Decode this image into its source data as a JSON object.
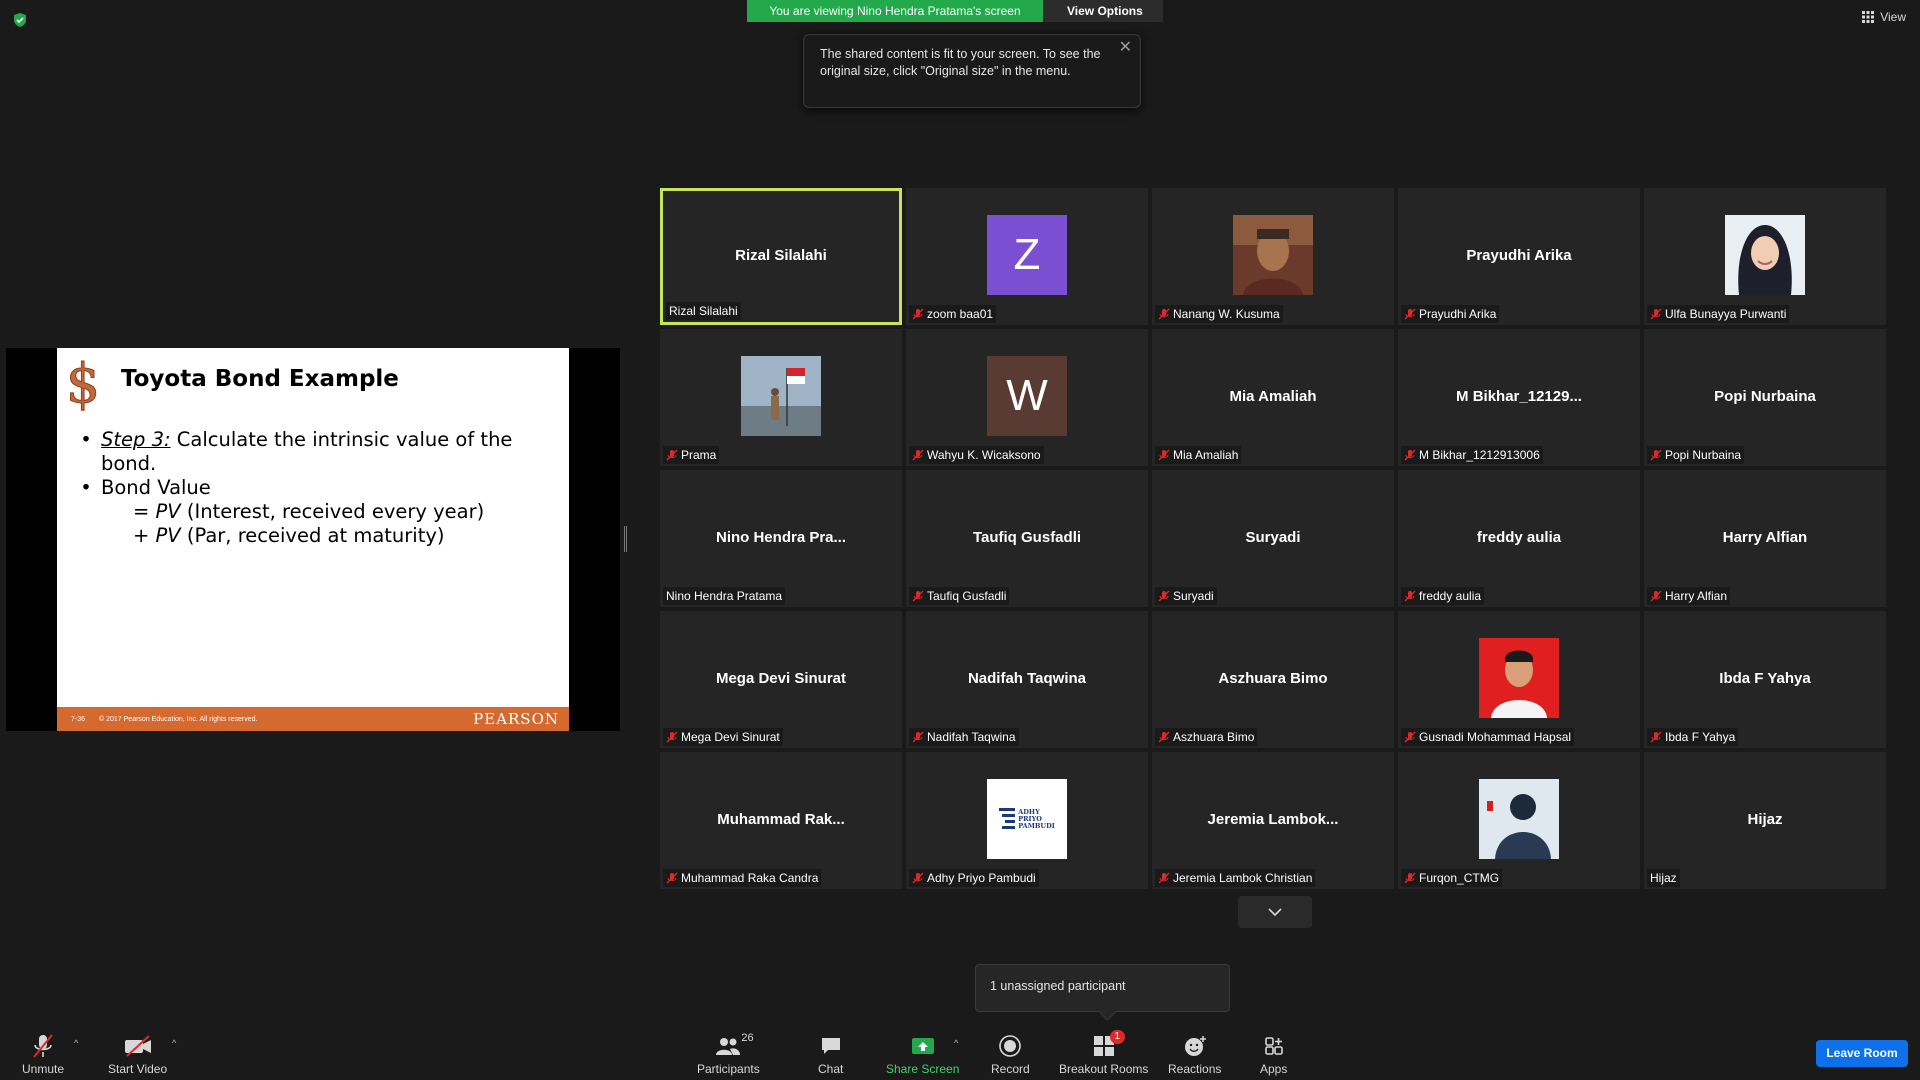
{
  "banner": {
    "viewing": "You are viewing Nino Hendra Pratama's screen",
    "view_options": "View Options"
  },
  "tooltip": {
    "text": "The shared content is fit to your screen. To see the original size, click \"Original size\" in the menu."
  },
  "view_button": "View",
  "slide": {
    "title": "Toyota Bond Example",
    "step_label": "Step 3:",
    "step_text": " Calculate the intrinsic value of the",
    "step_text2": "bond.",
    "bond_value": "Bond Value",
    "line1_pv": "PV",
    "line1_rest": " (Interest, received every year)",
    "line2_pv": "PV",
    "line2_rest": " (Par, received at maturity)",
    "footer_page": "7-36",
    "footer_copy": "© 2017 Pearson Education, Inc. All rights reserved.",
    "footer_brand": "PEARSON"
  },
  "participants": [
    {
      "big": "Rizal Silalahi",
      "name": "Rizal Silalahi",
      "muted": false,
      "active": true,
      "avatar": "none"
    },
    {
      "big": "",
      "name": "zoom baa01",
      "muted": true,
      "avatar": "initial",
      "initial": "Z",
      "color": "#7b4fd1"
    },
    {
      "big": "",
      "name": "Nanang W. Kusuma",
      "muted": true,
      "avatar": "photo-man"
    },
    {
      "big": "Prayudhi Arika",
      "name": "Prayudhi Arika",
      "muted": true,
      "avatar": "none"
    },
    {
      "big": "",
      "name": "Ulfa Bunayya Purwanti",
      "muted": true,
      "avatar": "photo-hijab"
    },
    {
      "big": "",
      "name": "Prama",
      "muted": true,
      "avatar": "photo-flag"
    },
    {
      "big": "",
      "name": "Wahyu K. Wicaksono",
      "muted": true,
      "avatar": "initial",
      "initial": "W",
      "color": "#5a3b33"
    },
    {
      "big": "Mia Amaliah",
      "name": "Mia Amaliah",
      "muted": true,
      "avatar": "none"
    },
    {
      "big": "M  Bikhar_12129...",
      "name": "M Bikhar_1212913006",
      "muted": true,
      "avatar": "none"
    },
    {
      "big": "Popi Nurbaina",
      "name": "Popi Nurbaina",
      "muted": true,
      "avatar": "none"
    },
    {
      "big": "Nino  Hendra  Pra...",
      "name": "Nino Hendra Pratama",
      "muted": false,
      "avatar": "none"
    },
    {
      "big": "Taufiq Gusfadli",
      "name": "Taufiq Gusfadli",
      "muted": true,
      "avatar": "none"
    },
    {
      "big": "Suryadi",
      "name": "Suryadi",
      "muted": true,
      "avatar": "none"
    },
    {
      "big": "freddy aulia",
      "name": "freddy aulia",
      "muted": true,
      "avatar": "none"
    },
    {
      "big": "Harry Alfian",
      "name": "Harry Alfian",
      "muted": true,
      "avatar": "none"
    },
    {
      "big": "Mega Devi Sinurat",
      "name": "Mega Devi Sinurat",
      "muted": true,
      "avatar": "none"
    },
    {
      "big": "Nadifah Taqwina",
      "name": "Nadifah Taqwina",
      "muted": true,
      "avatar": "none"
    },
    {
      "big": "Aszhuara Bimo",
      "name": "Aszhuara Bimo",
      "muted": true,
      "avatar": "none"
    },
    {
      "big": "",
      "name": "Gusnadi Mohammad Hapsal",
      "muted": true,
      "avatar": "photo-red"
    },
    {
      "big": "Ibda F Yahya",
      "name": "Ibda F Yahya",
      "muted": true,
      "avatar": "none"
    },
    {
      "big": "Muhammad  Rak...",
      "name": "Muhammad Raka Candra",
      "muted": true,
      "avatar": "none"
    },
    {
      "big": "",
      "name": "Adhy Priyo Pambudi",
      "muted": true,
      "avatar": "photo-logo"
    },
    {
      "big": "Jeremia  Lambok...",
      "name": "Jeremia Lambok Christian",
      "muted": true,
      "avatar": "none"
    },
    {
      "big": "",
      "name": "Furqon_CTMG",
      "muted": true,
      "avatar": "photo-snow"
    },
    {
      "big": "Hijaz",
      "name": "Hijaz",
      "muted": false,
      "avatar": "none"
    }
  ],
  "logo_lines": [
    "ADHY",
    "PRIYO",
    "PAMBUDI"
  ],
  "unassigned": "1 unassigned participant",
  "toolbar": {
    "unmute": "Unmute",
    "start_video": "Start Video",
    "participants": "Participants",
    "participants_count": "26",
    "chat": "Chat",
    "share_screen": "Share Screen",
    "record": "Record",
    "breakout_rooms": "Breakout Rooms",
    "breakout_badge": "1",
    "reactions": "Reactions",
    "apps": "Apps",
    "leave_room": "Leave Room"
  },
  "colors": {
    "accent_green": "#23a94c",
    "active_border": "#c8e45a",
    "leave_blue": "#0e71eb",
    "slide_footer": "#d56a31",
    "mic_off_red": "#e02828"
  }
}
